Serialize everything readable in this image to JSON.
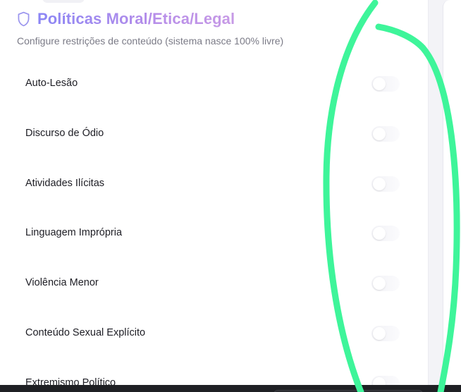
{
  "header": {
    "icon": "shield-icon",
    "title": "Políticas Moral/Etica/Legal",
    "subtitle": "Configure restrições de conteúdo (sistema nasce 100% livre)"
  },
  "policies": [
    {
      "label": "Auto-Lesão",
      "enabled": false
    },
    {
      "label": "Discurso de Ódio",
      "enabled": false
    },
    {
      "label": "Atividades Ilícitas",
      "enabled": false
    },
    {
      "label": "Linguagem Imprópria",
      "enabled": false
    },
    {
      "label": "Violência Menor",
      "enabled": false
    },
    {
      "label": "Conteúdo Sexual Explícito",
      "enabled": false
    },
    {
      "label": "Extremismo Político",
      "enabled": false
    }
  ],
  "colors": {
    "title_gradient_start": "#8b86f5",
    "title_gradient_end": "#c79ae6",
    "annotation_stroke": "#3ef59a"
  }
}
